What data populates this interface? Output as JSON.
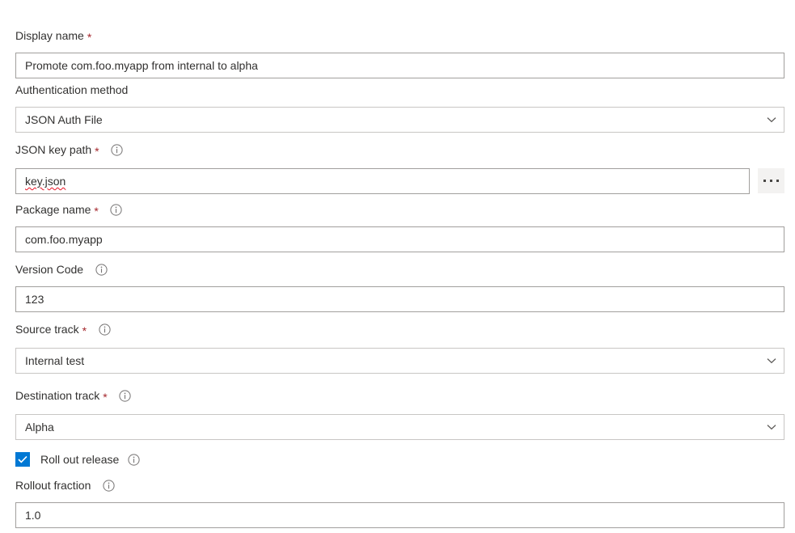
{
  "form": {
    "fields": [
      {
        "label": "Display name",
        "required": true,
        "info": false,
        "control": "text",
        "value": "Promote com.foo.myapp from internal to alpha"
      },
      {
        "label": "Authentication method",
        "required": false,
        "info": false,
        "control": "select",
        "value": "JSON Auth File"
      },
      {
        "label": "JSON key path",
        "required": true,
        "info": true,
        "control": "text-browse",
        "value": "key.json",
        "browse_label": "...",
        "misspelled": true
      },
      {
        "label": "Package name",
        "required": true,
        "info": true,
        "control": "text",
        "value": "com.foo.myapp"
      },
      {
        "label": "Version Code",
        "required": false,
        "info": true,
        "control": "text",
        "value": "123"
      },
      {
        "label": "Source track",
        "required": true,
        "info": true,
        "control": "select",
        "value": "Internal test"
      },
      {
        "label": "Destination track",
        "required": true,
        "info": true,
        "control": "select",
        "value": "Alpha"
      },
      {
        "label": "Roll out release",
        "required": false,
        "info": true,
        "control": "checkbox",
        "checked": true
      },
      {
        "label": "Rollout fraction",
        "required": false,
        "info": true,
        "control": "text",
        "value": "1.0"
      }
    ],
    "icons": {
      "info": "info-circle-icon",
      "chevron": "chevron-down-icon",
      "browse": "ellipsis-icon",
      "check": "checkmark-icon"
    },
    "colors": {
      "accent": "#0078d4",
      "required_asterisk": "#a4262c",
      "text": "#323130",
      "input_border": "#a19f9d",
      "select_border": "#c8c6c4",
      "button_bg": "#f3f2f1",
      "spellcheck_underline": "#e81123"
    }
  }
}
